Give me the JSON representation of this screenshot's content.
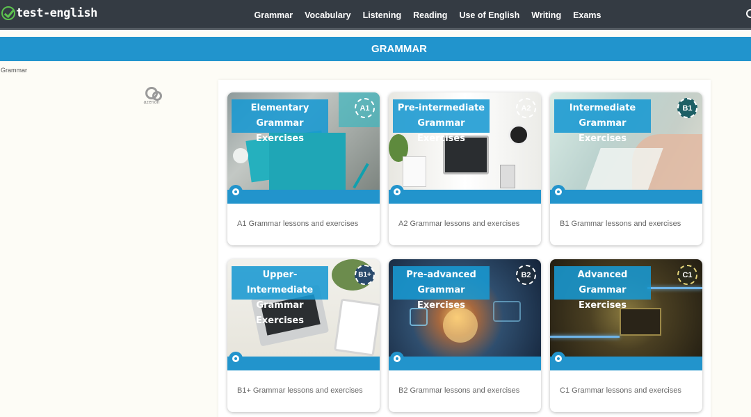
{
  "header": {
    "logo_text": "test-english",
    "nav": [
      "Grammar",
      "Vocabulary",
      "Listening",
      "Reading",
      "Use of English",
      "Writing",
      "Exams"
    ]
  },
  "band": {
    "title": "GRAMMAR"
  },
  "breadcrumb": "Grammar",
  "ad": {
    "label": "azerion"
  },
  "cards": [
    {
      "title_line1": "Elementary",
      "title_line2": "Grammar Exercises",
      "level": "A1",
      "description": "A1 Grammar lessons and exercises"
    },
    {
      "title_line1": "Pre-intermediate",
      "title_line2": "Grammar Exercises",
      "level": "A2",
      "description": "A2 Grammar lessons and exercises"
    },
    {
      "title_line1": "Intermediate",
      "title_line2": "Grammar Exercises",
      "level": "B1",
      "description": "B1 Grammar lessons and exercises"
    },
    {
      "title_line1": "Upper-Intermediate",
      "title_line2": "Grammar Exercises",
      "level": "B1+",
      "description": "B1+ Grammar lessons and exercises"
    },
    {
      "title_line1": "Pre-advanced",
      "title_line2": "Grammar Exercises",
      "level": "B2",
      "description": "B2 Grammar lessons and exercises"
    },
    {
      "title_line1": "Advanced",
      "title_line2": "Grammar Exercises",
      "level": "C1",
      "description": "C1 Grammar lessons and exercises"
    }
  ],
  "colors": {
    "header_bg": "#343b43",
    "accent_blue": "#2194cd",
    "logo_check": "#5cc24e"
  }
}
